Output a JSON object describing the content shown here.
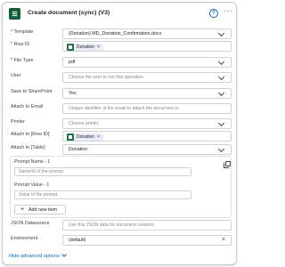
{
  "header": {
    "title": "Create document (sync) (V3)",
    "help_icon": "?",
    "more_icon": "···"
  },
  "fields": {
    "template": {
      "label": "* Template",
      "value": "(Donation) MD_Donation_Confirmation.docx"
    },
    "row_id": {
      "label": "* Row ID",
      "token": "Donation"
    },
    "file_type": {
      "label": "* File Type",
      "value": "pdf"
    },
    "user": {
      "label": "User",
      "placeholder": "Choose the user to run this operation."
    },
    "save_to_sharepoint": {
      "label": "Save to SharePoint",
      "value": "Yes"
    },
    "attach_to_email": {
      "label": "Attach to Email",
      "placeholder": "Unique identifier of the email to attach the document to."
    },
    "printer": {
      "label": "Printer",
      "placeholder": "Choose printer."
    },
    "attach_to_row_id": {
      "label": "Attach to [Row ID]",
      "token": "Donation"
    },
    "attach_to_table": {
      "label": "Attach to [Table]",
      "value": "Donation"
    },
    "json_datasource": {
      "label": "JSON Datasource",
      "placeholder": "Use this JSON data for document creation."
    },
    "environment": {
      "label": "Environment",
      "value": "(default)"
    }
  },
  "prompt_group": {
    "name_label": "Prompt Name - 1",
    "name_placeholder": "Name/Id of the prompt.",
    "value_label": "Prompt Value - 1",
    "value_placeholder": "Value of the prompt.",
    "add_button": "Add new item"
  },
  "footer": {
    "advanced_link": "Hide advanced options"
  },
  "colors": {
    "accent": "#0f6cbd",
    "token_bg": "#e8ebfa",
    "excel_green": "#217346"
  }
}
